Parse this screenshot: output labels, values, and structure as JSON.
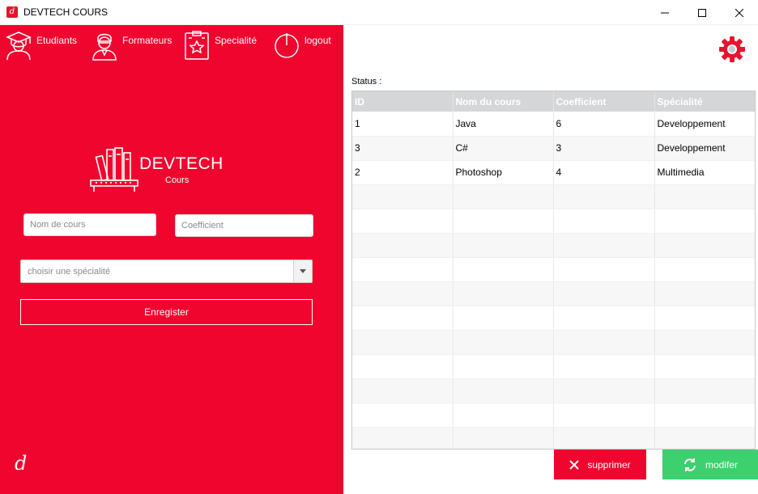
{
  "window": {
    "title": "DEVTECH COURS",
    "icon": "devtech-logo-icon"
  },
  "nav": {
    "items": [
      {
        "label": "Etudiants",
        "icon": "graduate-icon"
      },
      {
        "label": "Formateurs",
        "icon": "teacher-icon"
      },
      {
        "label": "Specialité",
        "icon": "certificate-icon"
      },
      {
        "label": "logout",
        "icon": "power-icon"
      }
    ]
  },
  "brand": {
    "title": "DEVTECH",
    "subtitle": "Cours",
    "icon": "bookshelf-icon"
  },
  "form": {
    "course_placeholder": "Nom de cours",
    "coefficient_placeholder": "Coefficient",
    "speciality_placeholder": "choisir une spécialité",
    "save_label": "Enregister"
  },
  "status": {
    "label": "Status :"
  },
  "table": {
    "columns": [
      "ID",
      "Nom du cours",
      "Coefficient",
      "Spécialité"
    ],
    "rows": [
      [
        "1",
        "Java",
        "6",
        "Developpement"
      ],
      [
        "3",
        "C#",
        "3",
        "Developpement"
      ],
      [
        "2",
        "Photoshop",
        "4",
        "Multimedia"
      ]
    ],
    "empty_rows": 11
  },
  "actions": {
    "delete_label": "supprimer",
    "modify_label": "modifer"
  },
  "colors": {
    "accent_red": "#f0052e",
    "accent_green": "#3dd06e",
    "header_grey": "#d5d6d8"
  }
}
